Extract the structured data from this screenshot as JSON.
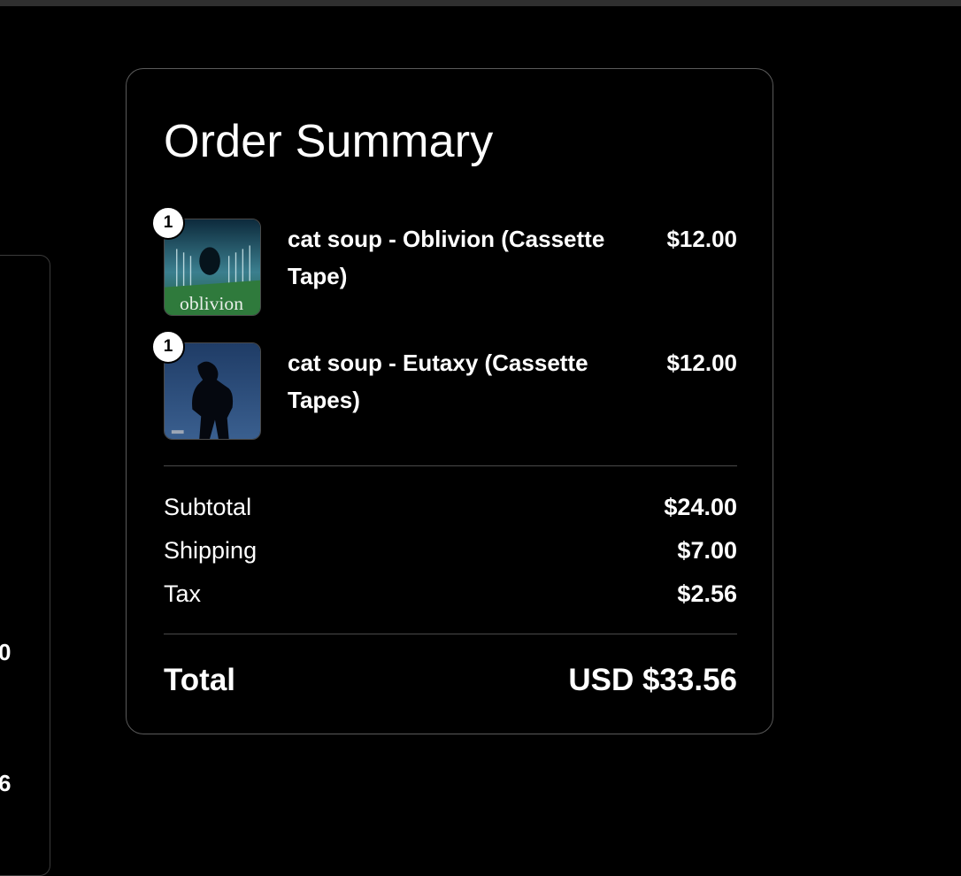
{
  "left_panel": {
    "fragments": [
      "0",
      "6"
    ]
  },
  "order_summary": {
    "title": "Order Summary",
    "items": [
      {
        "quantity": "1",
        "name": "cat soup - Oblivion (Cassette Tape)",
        "price": "$12.00",
        "cover_text": "oblivion"
      },
      {
        "quantity": "1",
        "name": "cat soup - Eutaxy (Cassette Tapes)",
        "price": "$12.00"
      }
    ],
    "subtotal_label": "Subtotal",
    "subtotal_value": "$24.00",
    "shipping_label": "Shipping",
    "shipping_value": "$7.00",
    "tax_label": "Tax",
    "tax_value": "$2.56",
    "total_label": "Total",
    "total_value": "USD $33.56"
  },
  "colors": {
    "background": "#000000",
    "card_border": "#5a5a5a",
    "text": "#ffffff"
  }
}
